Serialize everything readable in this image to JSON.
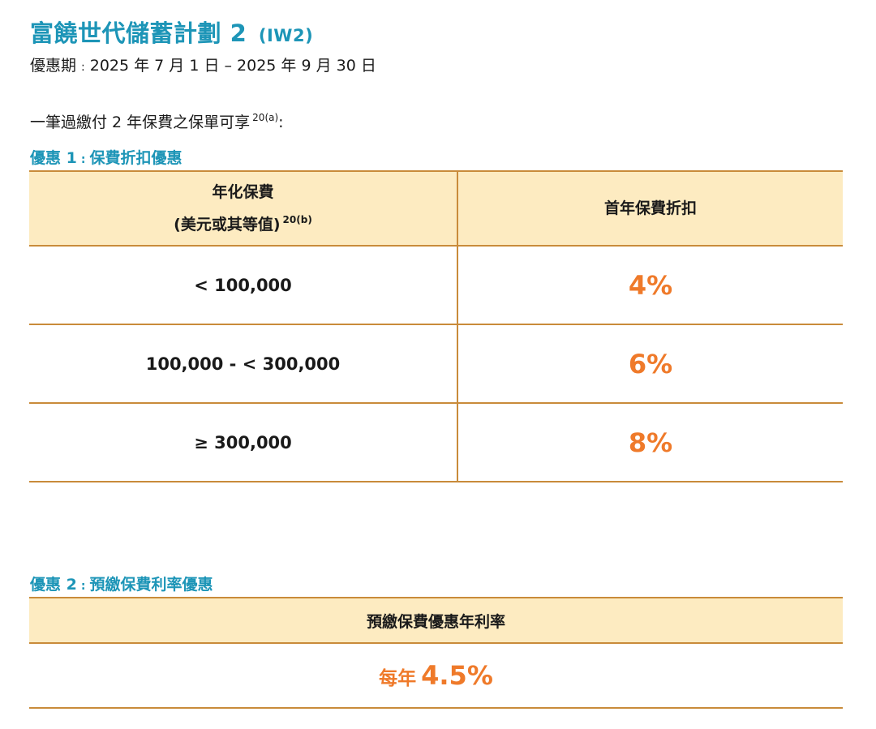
{
  "title": {
    "name": "富饒世代儲蓄計劃 2",
    "code": "(IW2)"
  },
  "period": {
    "label": "優惠期",
    "separator": ":",
    "range": "2025 年 7 月 1 日 – 2025 年 9 月 30 日"
  },
  "intro": {
    "text": "一筆過繳付 2 年保費之保單可享",
    "note": "20(a)",
    "suffix": ":"
  },
  "offer1": {
    "title_prefix": "優惠 1",
    "separator": ":",
    "title": "保費折扣優惠",
    "header": {
      "col1_line1": "年化保費",
      "col1_line2": "(美元或其等值)",
      "col1_note": "20(b)",
      "col2": "首年保費折扣"
    },
    "rows": [
      {
        "range": "< 100,000",
        "discount": "4%"
      },
      {
        "range": "100,000 - < 300,000",
        "discount": "6%"
      },
      {
        "range": "≥ 300,000",
        "discount": "8%"
      }
    ]
  },
  "offer2": {
    "title_prefix": "優惠 2",
    "separator": ":",
    "title": "預繳保費利率優惠",
    "header": "預繳保費優惠年利率",
    "rate_prefix": "每年",
    "rate": "4.5%"
  },
  "colors": {
    "accent": "#1d95b7",
    "highlight": "#ef7a2a",
    "header_bg": "#fdebc1",
    "border": "#c98b3a"
  }
}
